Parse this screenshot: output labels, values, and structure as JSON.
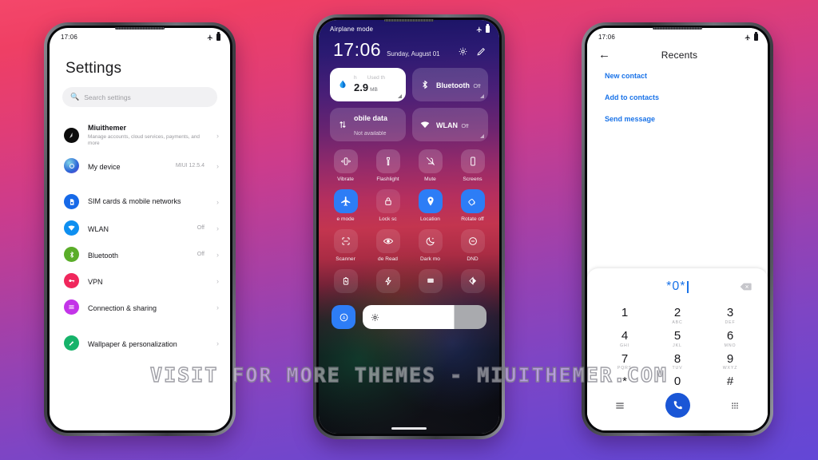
{
  "watermark": {
    "text": "VISIT FOR MORE THEMES - MIUITHEMER.COM"
  },
  "background": {
    "top_color": "#f4476a",
    "bottom_color": "#6347d6"
  },
  "phones": {
    "settings": {
      "status_bar": {
        "time": "17:06",
        "airplane_icon": "airplane-icon",
        "battery_icon": "battery-icon"
      },
      "title": "Settings",
      "search": {
        "placeholder": "Search settings",
        "icon": "search-icon"
      },
      "items": [
        {
          "label": "Miuithemer",
          "sub": "Manage accounts, cloud services, payments, and more",
          "value": "",
          "icon": "account-avatar-icon",
          "color": "#0c0c0c"
        },
        {
          "label": "My device",
          "sub": "",
          "value": "MIUI 12.5.4",
          "icon": "device-icon",
          "color": "#4c7ff0"
        },
        {
          "label": "SIM cards & mobile networks",
          "sub": "",
          "value": "",
          "icon": "sim-card-icon",
          "color": "#1669e8"
        },
        {
          "label": "WLAN",
          "sub": "",
          "value": "Off",
          "icon": "wifi-icon",
          "color": "#0e8ff0"
        },
        {
          "label": "Bluetooth",
          "sub": "",
          "value": "Off",
          "icon": "bluetooth-icon",
          "color": "#5aad29"
        },
        {
          "label": "VPN",
          "sub": "",
          "value": "",
          "icon": "key-icon",
          "color": "#f0275c"
        },
        {
          "label": "Connection & sharing",
          "sub": "",
          "value": "",
          "icon": "connection-icon",
          "color": "#c334e8"
        },
        {
          "label": "Wallpaper & personalization",
          "sub": "",
          "value": "",
          "icon": "brush-icon",
          "color": "#16b36a"
        }
      ],
      "chevron": "›"
    },
    "control_center": {
      "status_bar": {
        "label": "Airplane mode",
        "airplane_icon": "airplane-icon",
        "battery_icon": "battery-icon"
      },
      "clock": {
        "time": "17:06",
        "date": "Sunday, August 01"
      },
      "actions": [
        {
          "name": "settings-gear-button",
          "icon": "gear-icon"
        },
        {
          "name": "edit-button",
          "icon": "pencil-icon"
        }
      ],
      "big_tiles": [
        {
          "kind": "data",
          "title_left": "h",
          "title_right": "Used th",
          "value": "2.9",
          "unit": "MB",
          "icon": "data-drop-icon",
          "state_on": true
        },
        {
          "kind": "toggle",
          "name": "Bluetooth",
          "state": "Off",
          "icon": "bluetooth-icon",
          "state_on": false
        },
        {
          "kind": "toggle",
          "name": "obile data",
          "state": "Not available",
          "icon": "mobile-data-icon",
          "state_on": false
        },
        {
          "kind": "toggle",
          "name": "WLAN",
          "state": "Off",
          "icon": "wifi-icon",
          "state_on": false
        }
      ],
      "quick_settings": [
        {
          "label": "Vibrate",
          "icon": "vibrate-icon",
          "active": false
        },
        {
          "label": "Flashlight",
          "icon": "flashlight-icon",
          "active": false
        },
        {
          "label": "Mute",
          "icon": "mute-bell-icon",
          "active": false
        },
        {
          "label": "Screens",
          "icon": "screenshot-icon",
          "active": false
        },
        {
          "label": "e mode",
          "icon": "airplane-icon",
          "active": true
        },
        {
          "label": "Lock sc",
          "icon": "lock-icon",
          "active": false
        },
        {
          "label": "Location",
          "icon": "location-pin-icon",
          "active": true
        },
        {
          "label": "Rotate off",
          "icon": "rotate-lock-icon",
          "active": true
        },
        {
          "label": "Scanner",
          "icon": "scanner-icon",
          "active": false
        },
        {
          "label": "de   Read",
          "icon": "eye-icon",
          "active": false
        },
        {
          "label": "Dark mo",
          "icon": "moon-icon",
          "active": false
        },
        {
          "label": "DND",
          "icon": "dnd-icon",
          "active": false
        },
        {
          "label": "",
          "icon": "battery-saver-icon",
          "active": false
        },
        {
          "label": "",
          "icon": "lightning-icon",
          "active": false
        },
        {
          "label": "",
          "icon": "cast-icon",
          "active": false
        },
        {
          "label": "",
          "icon": "theme-contrast-icon",
          "active": false
        }
      ],
      "brightness": {
        "auto_icon": "auto-brightness-icon",
        "slider_icon": "sun-icon",
        "level_percent": 74
      }
    },
    "dialer": {
      "status_bar": {
        "time": "17:06",
        "airplane_icon": "airplane-icon",
        "battery_icon": "battery-icon"
      },
      "back_icon": "back-arrow-icon",
      "title": "Recents",
      "links": [
        {
          "label": "New contact"
        },
        {
          "label": "Add to contacts"
        },
        {
          "label": "Send message"
        }
      ],
      "input": {
        "value": "*0*",
        "backspace_icon": "backspace-icon"
      },
      "keys": [
        {
          "digit": "1",
          "letters": " "
        },
        {
          "digit": "2",
          "letters": "ABC"
        },
        {
          "digit": "3",
          "letters": "DEF"
        },
        {
          "digit": "4",
          "letters": "GHI"
        },
        {
          "digit": "5",
          "letters": "JKL"
        },
        {
          "digit": "6",
          "letters": "MNO"
        },
        {
          "digit": "7",
          "letters": "PQRS"
        },
        {
          "digit": "8",
          "letters": "TUV"
        },
        {
          "digit": "9",
          "letters": "WXYZ"
        },
        {
          "digit": "*",
          "letters": ""
        },
        {
          "digit": "0",
          "letters": "+"
        },
        {
          "digit": "#",
          "letters": ""
        }
      ],
      "bottom": {
        "left_icon": "menu-list-icon",
        "call_icon": "phone-call-icon",
        "right_icon": "keypad-grid-icon",
        "call_color": "#1a56d6"
      }
    }
  }
}
